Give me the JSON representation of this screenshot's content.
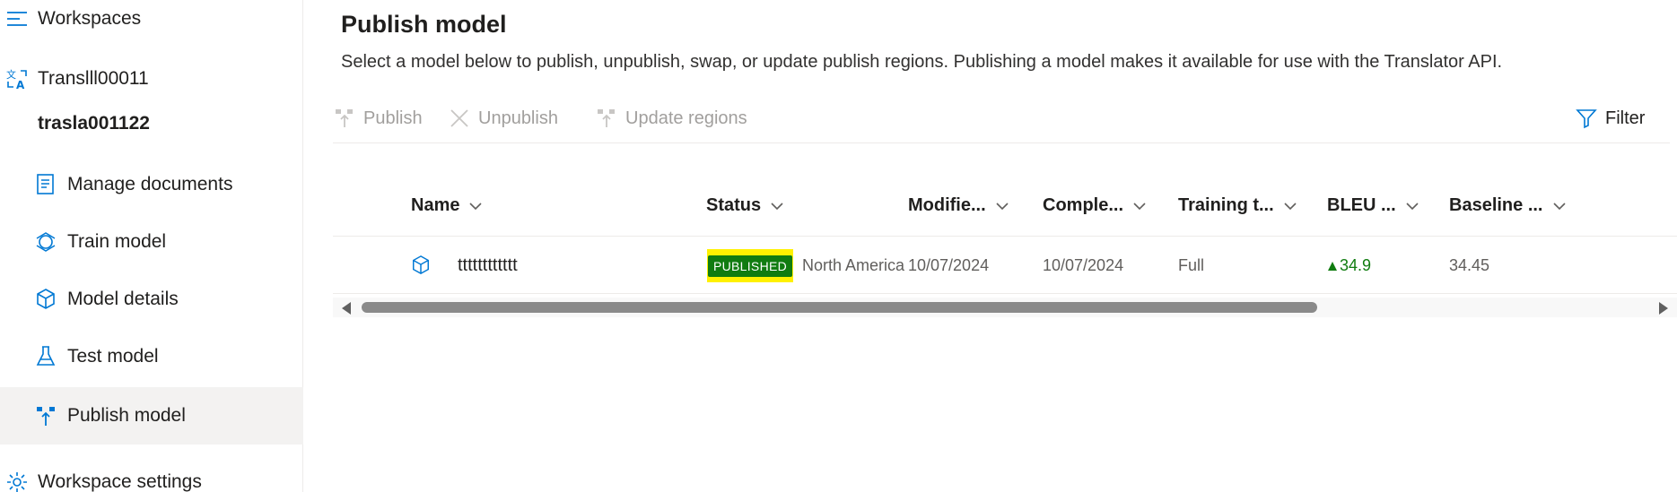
{
  "sidebar": {
    "workspaces_label": "Workspaces",
    "project_label": "Translll00011",
    "workspace_name": "trasla001122",
    "items": [
      {
        "label": "Manage documents",
        "icon": "document-icon"
      },
      {
        "label": "Train model",
        "icon": "train-icon"
      },
      {
        "label": "Model details",
        "icon": "cube-icon"
      },
      {
        "label": "Test model",
        "icon": "flask-icon"
      },
      {
        "label": "Publish model",
        "icon": "publish-icon",
        "selected": true
      }
    ],
    "settings_label": "Workspace settings"
  },
  "page": {
    "title": "Publish model",
    "description": "Select a model below to publish, unpublish, swap, or update publish regions. Publishing a model makes it available for use with the Translator API."
  },
  "toolbar": {
    "publish_label": "Publish",
    "unpublish_label": "Unpublish",
    "update_regions_label": "Update regions",
    "filter_label": "Filter"
  },
  "table": {
    "columns": [
      "Name",
      "Status",
      "Modifie...",
      "Comple...",
      "Training t...",
      "BLEU ...",
      "Baseline ..."
    ],
    "rows": [
      {
        "name": "tttttttttttt",
        "status_badge": "PUBLISHED",
        "region": "North America",
        "modified": "10/07/2024",
        "completed": "10/07/2024",
        "training_type": "Full",
        "bleu": "34.9",
        "baseline": "34.45"
      }
    ]
  },
  "colors": {
    "accent": "#0078d4",
    "success": "#107c10",
    "highlight": "#fff100",
    "selected_bg": "#f3f2f1"
  }
}
